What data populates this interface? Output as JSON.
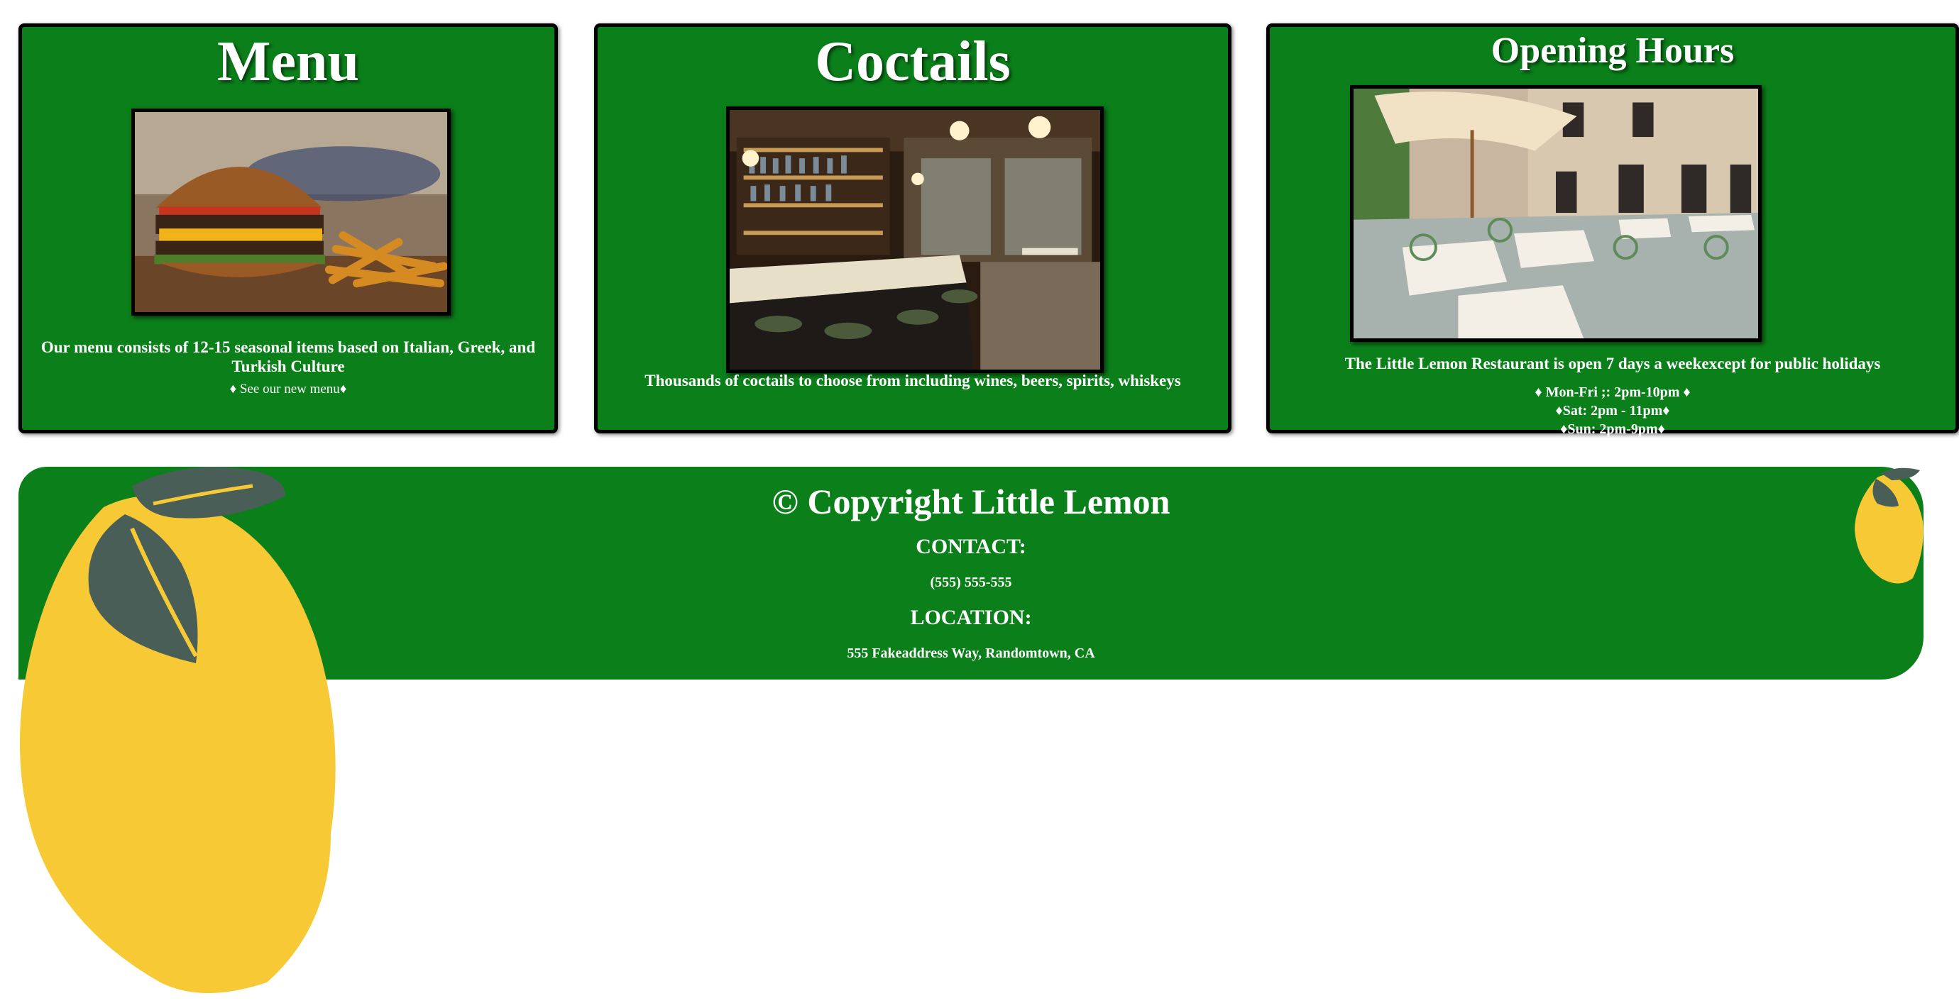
{
  "menu_card": {
    "title": "Menu",
    "image_alt": "burger-with-fries-photo",
    "description": "Our menu consists of 12-15 seasonal items based on Italian, Greek, and Turkish Culture",
    "link_text": "♦ See our new menu♦"
  },
  "cocktails_card": {
    "title": "Coctails",
    "image_alt": "bar-interior-photo",
    "description": "Thousands of coctails to choose from including wines, beers, spirits, whiskeys"
  },
  "hours_card": {
    "title": "Opening Hours",
    "image_alt": "courtyard-restaurant-photo",
    "description": "The Little Lemon Restaurant is open 7 days a weekexcept for public holidays",
    "hours": [
      "♦ Mon-Fri ;: 2pm-10pm ♦",
      "♦Sat: 2pm - 11pm♦",
      "♦Sun: 2pm-9pm♦"
    ]
  },
  "footer": {
    "copyright": "© Copyright Little Lemon",
    "contact_label": "CONTACT:",
    "phone": "(555) 555-555",
    "location_label": "LOCATION:",
    "address": "555 Fakeaddress Way, Randomtown, CA"
  },
  "colors": {
    "brand_green": "#0b7f1a",
    "lemon_yellow": "#f7c934",
    "leaf_gray": "#495e57"
  },
  "icons": [
    "large-lemon-icon",
    "small-lemon-icon"
  ]
}
